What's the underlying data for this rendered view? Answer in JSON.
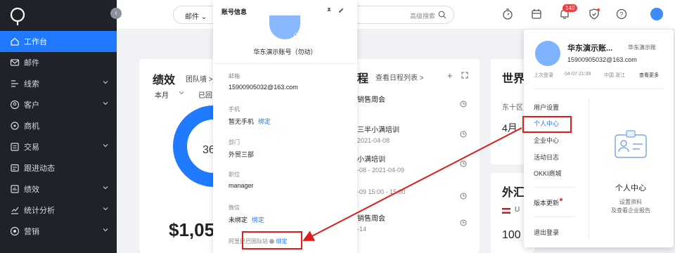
{
  "sidebar": {
    "items": [
      {
        "label": "工作台",
        "icon": "home-icon",
        "active": true,
        "has_chevron": false
      },
      {
        "label": "邮件",
        "icon": "mail-icon",
        "active": false,
        "has_chevron": false
      },
      {
        "label": "线索",
        "icon": "leads-icon",
        "active": false,
        "has_chevron": true
      },
      {
        "label": "客户",
        "icon": "customer-icon",
        "active": false,
        "has_chevron": true
      },
      {
        "label": "商机",
        "icon": "opportunity-icon",
        "active": false,
        "has_chevron": false
      },
      {
        "label": "交易",
        "icon": "trade-icon",
        "active": false,
        "has_chevron": true
      },
      {
        "label": "跟进动态",
        "icon": "followup-icon",
        "active": false,
        "has_chevron": false
      },
      {
        "label": "绩效",
        "icon": "performance-icon",
        "active": false,
        "has_chevron": true
      },
      {
        "label": "统计分析",
        "icon": "analytics-icon",
        "active": false,
        "has_chevron": true
      },
      {
        "label": "营销",
        "icon": "marketing-icon",
        "active": false,
        "has_chevron": true
      }
    ]
  },
  "topbar": {
    "search_scope": "邮件",
    "advanced_search": "高级搜索",
    "notification_count": "140"
  },
  "performance": {
    "title": "绩效",
    "team_link": "团队墙 >",
    "period": "本月",
    "returned": "已回",
    "donut_value": "36",
    "amount": "$1,05"
  },
  "schedule": {
    "title": "程",
    "view_list": "查看日程列表 >",
    "items": [
      {
        "title": "销售周会",
        "date": ""
      },
      {
        "title": "三半小满培训",
        "date": "2021-04-08"
      },
      {
        "title": "小满培训",
        "date": "-08 - 2021-04-09"
      },
      {
        "title": "",
        "date": "-09 15:00 - 15:00"
      },
      {
        "title": "销售周会",
        "date": "-14"
      }
    ]
  },
  "world": {
    "title": "世界",
    "subtitle": "东十区",
    "date": "4月"
  },
  "fx": {
    "title": "外汇",
    "currency": "U",
    "value": "100"
  },
  "account_panel": {
    "header": "账号信息",
    "name": "华东演示账号（勿动）",
    "fields": [
      {
        "label": "邮箱",
        "value": "15900905032@163.com",
        "bind": ""
      },
      {
        "label": "手机",
        "value": "暂无手机",
        "bind": "绑定"
      },
      {
        "label": "部门",
        "value": "外贸三部",
        "bind": ""
      },
      {
        "label": "职位",
        "value": "manager",
        "bind": ""
      },
      {
        "label": "微信",
        "value": "未绑定",
        "bind": "绑定"
      }
    ],
    "alibaba_label": "阿里巴巴国际站",
    "alibaba_bind": "绑定"
  },
  "user_dropdown": {
    "name": "华东演示账...",
    "company": "华东演示账",
    "email": "15900905032@163.com",
    "last_login_label": "上次登录",
    "last_login_time": "04-07 21:39",
    "last_login_location": "中国 浙江",
    "view_more": "查看更多",
    "menu": [
      "用户设置",
      "个人中心",
      "企业中心",
      "活动日志",
      "OKKI商城",
      "版本更新",
      "退出登录"
    ],
    "card_title": "个人中心",
    "card_desc_1": "设置资料",
    "card_desc_2": "及查看企业报告"
  },
  "colors": {
    "sidebar_bg": "#1f2329",
    "accent": "#1f7aff",
    "highlight": "#e01b1b"
  }
}
